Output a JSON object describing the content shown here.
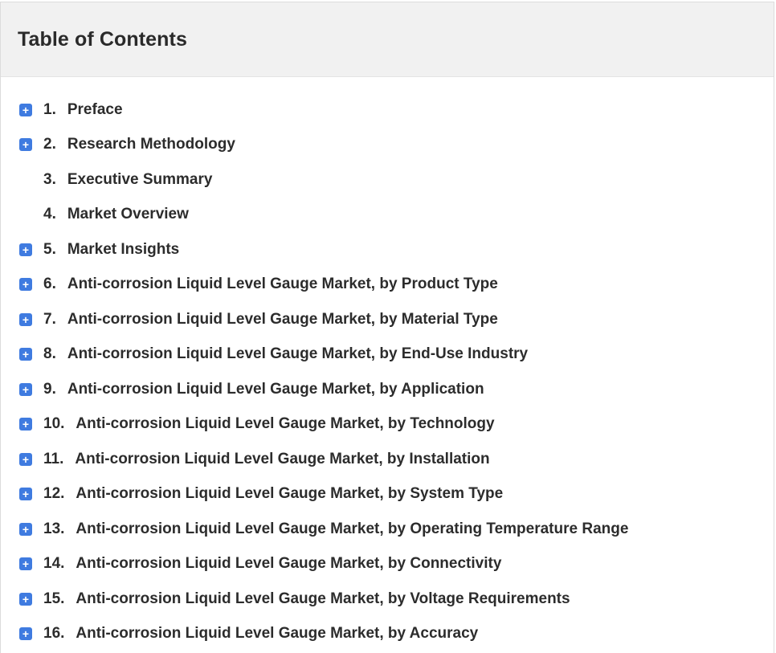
{
  "toc": {
    "title": "Table of Contents",
    "accent_color": "#3f7be0",
    "items": [
      {
        "number": "1.",
        "label": "Preface",
        "expandable": true
      },
      {
        "number": "2.",
        "label": "Research Methodology",
        "expandable": true
      },
      {
        "number": "3.",
        "label": "Executive Summary",
        "expandable": false
      },
      {
        "number": "4.",
        "label": "Market Overview",
        "expandable": false
      },
      {
        "number": "5.",
        "label": "Market Insights",
        "expandable": true
      },
      {
        "number": "6.",
        "label": "Anti-corrosion Liquid Level Gauge Market, by Product Type",
        "expandable": true
      },
      {
        "number": "7.",
        "label": "Anti-corrosion Liquid Level Gauge Market, by Material Type",
        "expandable": true
      },
      {
        "number": "8.",
        "label": "Anti-corrosion Liquid Level Gauge Market, by End-Use Industry",
        "expandable": true
      },
      {
        "number": "9.",
        "label": "Anti-corrosion Liquid Level Gauge Market, by Application",
        "expandable": true
      },
      {
        "number": "10.",
        "label": "Anti-corrosion Liquid Level Gauge Market, by Technology",
        "expandable": true
      },
      {
        "number": "11.",
        "label": "Anti-corrosion Liquid Level Gauge Market, by Installation",
        "expandable": true
      },
      {
        "number": "12.",
        "label": "Anti-corrosion Liquid Level Gauge Market, by System Type",
        "expandable": true
      },
      {
        "number": "13.",
        "label": "Anti-corrosion Liquid Level Gauge Market, by Operating Temperature Range",
        "expandable": true
      },
      {
        "number": "14.",
        "label": "Anti-corrosion Liquid Level Gauge Market, by Connectivity",
        "expandable": true
      },
      {
        "number": "15.",
        "label": "Anti-corrosion Liquid Level Gauge Market, by Voltage Requirements",
        "expandable": true
      },
      {
        "number": "16.",
        "label": "Anti-corrosion Liquid Level Gauge Market, by Accuracy",
        "expandable": true
      }
    ],
    "expand_icon": "plus-icon",
    "expand_glyph": "+"
  }
}
